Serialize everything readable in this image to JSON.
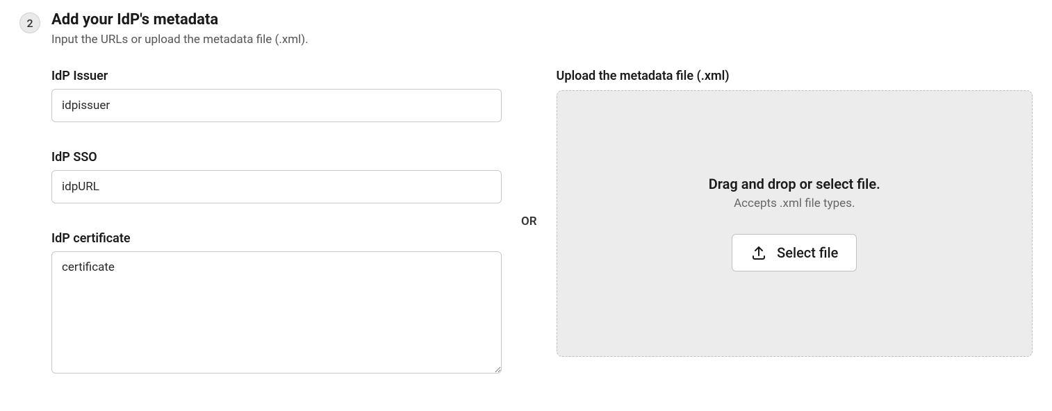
{
  "step": {
    "number": "2",
    "title": "Add your IdP's metadata",
    "subtitle": "Input the URLs or upload the metadata file (.xml)."
  },
  "form": {
    "issuer": {
      "label": "IdP Issuer",
      "value": "idpissuer"
    },
    "sso": {
      "label": "IdP SSO",
      "value": "idpURL"
    },
    "certificate": {
      "label": "IdP certificate",
      "value": "certificate"
    }
  },
  "separator": "OR",
  "upload": {
    "label": "Upload the metadata file (.xml)",
    "dropzone_title": "Drag and drop or select file.",
    "dropzone_hint": "Accepts .xml file types.",
    "button_label": "Select file"
  }
}
